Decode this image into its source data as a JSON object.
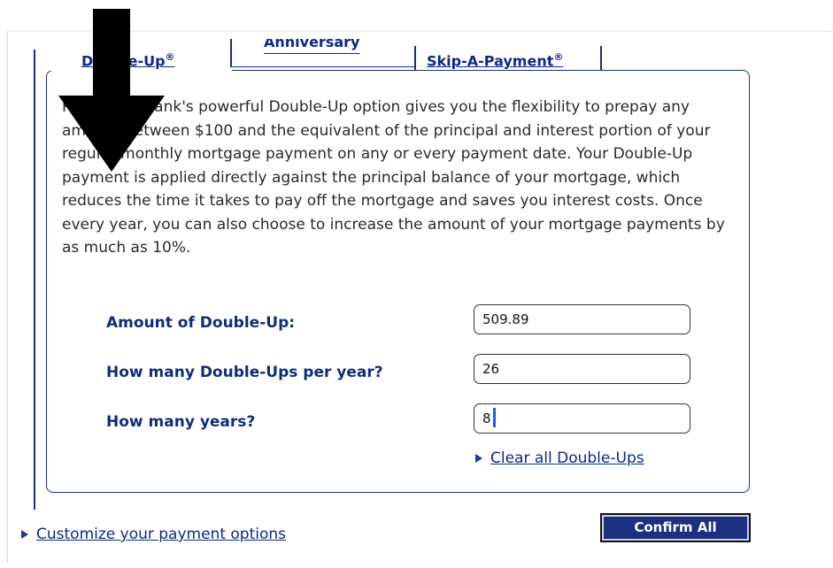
{
  "tabs": {
    "double_up": "Double-Up",
    "double_up_mark": "®",
    "anniversary": "Anniversary",
    "skip_a_payment": "Skip-A-Payment",
    "skip_a_payment_mark": "®"
  },
  "description": "RBC Royal Bank's powerful Double-Up option gives you the flexibility to prepay any amount between $100 and the equivalent of the principal and interest portion of your regular monthly mortgage payment on any or every payment date. Your Double-Up payment is applied directly against the principal balance of your mortgage, which reduces the time it takes to pay off the mortgage and saves you interest costs. Once every year, you can also choose to increase the amount of your mortgage payments by as much as 10%.",
  "form": {
    "amount_label": "Amount of Double-Up:",
    "amount_value": "509.89",
    "per_year_label": "How many Double-Ups per year?",
    "per_year_value": "26",
    "years_label": "How many years?",
    "years_value": "8"
  },
  "links": {
    "clear_all": "Clear all Double-Ups",
    "customize": "Customize your payment options"
  },
  "buttons": {
    "confirm_all": "Confirm All"
  },
  "colors": {
    "brand_navy": "#1a2f7a",
    "link_blue": "#0b2a86"
  },
  "icons": {
    "link_bullet": "triangle-right-icon",
    "overlay": "arrow-down-icon"
  }
}
